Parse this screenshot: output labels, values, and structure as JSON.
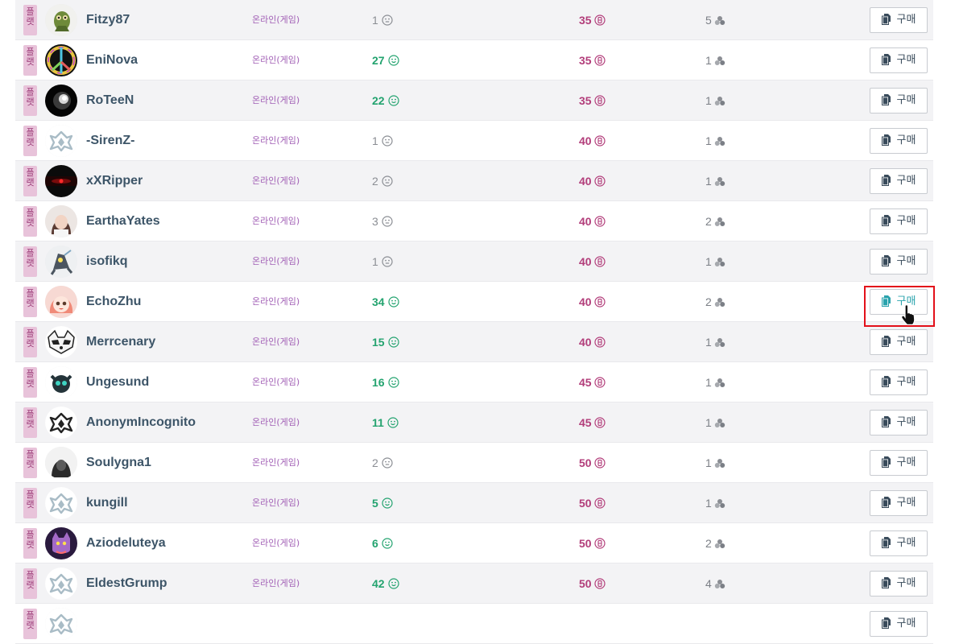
{
  "orders": [
    {
      "platform_tag": "플랫",
      "username": "Fitzy87",
      "status": "온라인(게임)",
      "reputation": "1",
      "reputation_level": "low",
      "price": "35",
      "quantity": "5",
      "avatar": "creature-green",
      "buy_label": "구매"
    },
    {
      "platform_tag": "플랫",
      "username": "EniNova",
      "status": "온라인(게임)",
      "reputation": "27",
      "reputation_level": "high",
      "price": "35",
      "quantity": "1",
      "avatar": "peace-sign",
      "buy_label": "구매"
    },
    {
      "platform_tag": "플랫",
      "username": "RoTeeN",
      "status": "온라인(게임)",
      "reputation": "22",
      "reputation_level": "high",
      "price": "35",
      "quantity": "1",
      "avatar": "dark-orb",
      "buy_label": "구매"
    },
    {
      "platform_tag": "플랫",
      "username": "-SirenZ-",
      "status": "온라인(게임)",
      "reputation": "1",
      "reputation_level": "low",
      "price": "40",
      "quantity": "1",
      "avatar": "warframe-logo",
      "buy_label": "구매"
    },
    {
      "platform_tag": "플랫",
      "username": "xXRipper",
      "status": "온라인(게임)",
      "reputation": "2",
      "reputation_level": "low",
      "price": "40",
      "quantity": "1",
      "avatar": "red-eye",
      "buy_label": "구매"
    },
    {
      "platform_tag": "플랫",
      "username": "EarthaYates",
      "status": "온라인(게임)",
      "reputation": "3",
      "reputation_level": "low",
      "price": "40",
      "quantity": "2",
      "avatar": "anime-girl-dark",
      "buy_label": "구매"
    },
    {
      "platform_tag": "플랫",
      "username": "isofikq",
      "status": "온라인(게임)",
      "reputation": "1",
      "reputation_level": "low",
      "price": "40",
      "quantity": "1",
      "avatar": "mech-creature",
      "buy_label": "구매"
    },
    {
      "platform_tag": "플랫",
      "username": "EchoZhu",
      "status": "온라인(게임)",
      "reputation": "34",
      "reputation_level": "high",
      "price": "40",
      "quantity": "2",
      "avatar": "anime-girl-pink",
      "buy_label": "구매",
      "hovered": true
    },
    {
      "platform_tag": "플랫",
      "username": "Merrcenary",
      "status": "온라인(게임)",
      "reputation": "15",
      "reputation_level": "high",
      "price": "40",
      "quantity": "1",
      "avatar": "raccoon",
      "buy_label": "구매"
    },
    {
      "platform_tag": "플랫",
      "username": "Ungesund",
      "status": "온라인(게임)",
      "reputation": "16",
      "reputation_level": "high",
      "price": "45",
      "quantity": "1",
      "avatar": "teal-creature",
      "buy_label": "구매"
    },
    {
      "platform_tag": "플랫",
      "username": "AnonymIncognito",
      "status": "온라인(게임)",
      "reputation": "11",
      "reputation_level": "high",
      "price": "45",
      "quantity": "1",
      "avatar": "warframe-logo-dark",
      "buy_label": "구매"
    },
    {
      "platform_tag": "플랫",
      "username": "Soulygna1",
      "status": "온라인(게임)",
      "reputation": "2",
      "reputation_level": "low",
      "price": "50",
      "quantity": "1",
      "avatar": "hooded-figure",
      "buy_label": "구매"
    },
    {
      "platform_tag": "플랫",
      "username": "kungill",
      "status": "온라인(게임)",
      "reputation": "5",
      "reputation_level": "high",
      "price": "50",
      "quantity": "1",
      "avatar": "warframe-logo",
      "buy_label": "구매"
    },
    {
      "platform_tag": "플랫",
      "username": "Aziodeluteya",
      "status": "온라인(게임)",
      "reputation": "6",
      "reputation_level": "high",
      "price": "50",
      "quantity": "2",
      "avatar": "purple-cat",
      "buy_label": "구매"
    },
    {
      "platform_tag": "플랫",
      "username": "EldestGrump",
      "status": "온라인(게임)",
      "reputation": "42",
      "reputation_level": "high",
      "price": "50",
      "quantity": "4",
      "avatar": "warframe-logo",
      "buy_label": "구매"
    },
    {
      "platform_tag": "플랫",
      "username": "",
      "status": "",
      "reputation": "",
      "reputation_level": "low",
      "price": "",
      "quantity": "",
      "avatar": "warframe-logo",
      "buy_label": "구매"
    }
  ],
  "colors": {
    "platform_tag_bg": "#e8c3da",
    "platform_tag_text": "#9b3a77",
    "status": "#a15eb5",
    "reputation_high": "#23a36f",
    "reputation_low": "#8b8e94",
    "price": "#b23d7a",
    "username": "#3d5568",
    "highlight": "#e3101a"
  },
  "icons": {
    "reputation": "smiley-icon",
    "price": "platinum-coin-icon",
    "quantity": "stack-icon",
    "buy": "copy-icon"
  }
}
